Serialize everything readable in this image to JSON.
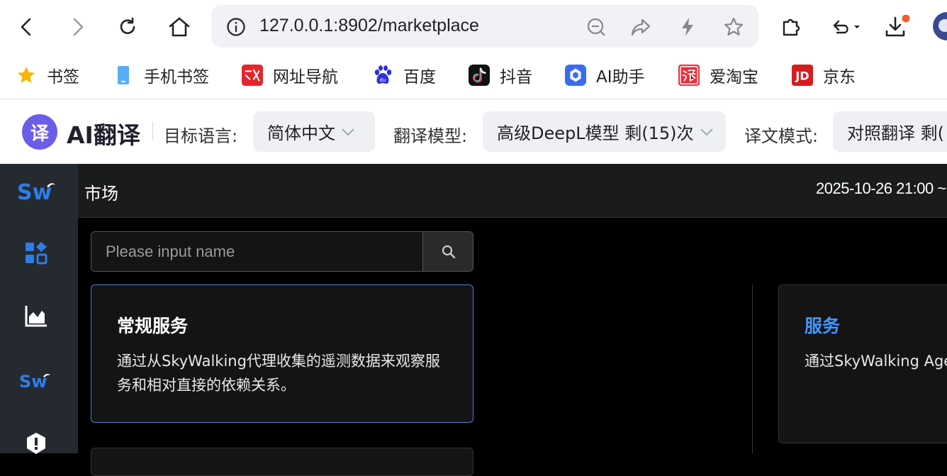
{
  "browser": {
    "url": "127.0.0.1:8902/marketplace"
  },
  "bookmarks": [
    {
      "label": "书签",
      "icon": "star-icon"
    },
    {
      "label": "手机书签",
      "icon": "phone-icon"
    },
    {
      "label": "网址导航",
      "icon": "nav-site-icon"
    },
    {
      "label": "百度",
      "icon": "baidu-icon"
    },
    {
      "label": "抖音",
      "icon": "douyin-icon"
    },
    {
      "label": "AI助手",
      "icon": "ai-assistant-icon"
    },
    {
      "label": "爱淘宝",
      "icon": "taobao-icon"
    },
    {
      "label": "京东",
      "icon": "jd-icon"
    }
  ],
  "translator": {
    "logo_char": "译",
    "title": "AI翻译",
    "target_lang_label": "目标语言:",
    "target_lang_value": "简体中文",
    "model_label": "翻译模型:",
    "model_value": "高级DeepL模型 剩(15)次",
    "mode_label": "译文模式:",
    "mode_value": "对照翻译 剩("
  },
  "app": {
    "logo_text": "Sw",
    "page_title": "市场",
    "time_range": "2025-10-26 21:00 ~",
    "search": {
      "placeholder": "Please input name"
    },
    "cards": [
      {
        "title": "常规服务",
        "description": "通过从SkyWalking代理收集的遥测数据来观察服务和相对直接的依赖关系。"
      },
      {
        "title": "服务",
        "description": "通过SkyWalking Agen"
      }
    ]
  },
  "colors": {
    "accent_blue": "#4196ff",
    "sidebar_bg": "#252a31",
    "active_border": "#4a7fd6"
  }
}
